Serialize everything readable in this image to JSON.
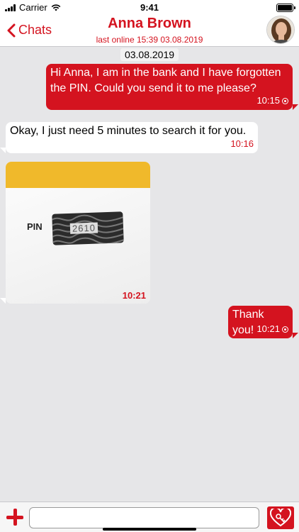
{
  "status_bar": {
    "carrier": "Carrier",
    "time": "9:41"
  },
  "header": {
    "back_label": "Chats",
    "title": "Anna Brown",
    "subtitle": "last online 15:39 03.08.2019"
  },
  "chat": {
    "date": "03.08.2019",
    "messages": [
      {
        "direction": "outgoing",
        "text": "Hi Anna, I am in the bank and I have forgotten the PIN. Could you send it to me please?",
        "time": "10:15"
      },
      {
        "direction": "incoming",
        "text": "Okay, I just need 5 minutes to search it for you.",
        "time": "10:16"
      },
      {
        "direction": "incoming",
        "type": "image",
        "image_text": "PIN",
        "image_code": "2610",
        "time": "10:21"
      },
      {
        "direction": "outgoing",
        "text": "Thank you!",
        "time": "10:21"
      }
    ]
  },
  "input_bar": {
    "placeholder": ""
  },
  "colors": {
    "accent": "#d4131f",
    "background": "#e6e6e8"
  }
}
